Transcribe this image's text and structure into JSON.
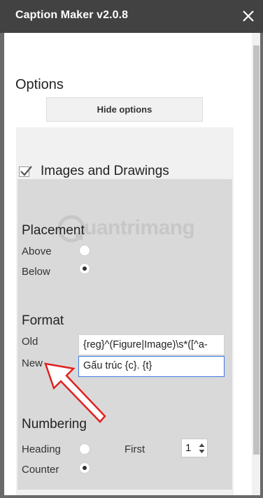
{
  "window": {
    "title": "Caption Maker v2.0.8"
  },
  "options": {
    "heading": "Options",
    "hide_button": "Hide options"
  },
  "images_drawings": {
    "label": "Images and Drawings",
    "checked": true
  },
  "placement": {
    "heading": "Placement",
    "above_label": "Above",
    "below_label": "Below",
    "selected": "Below"
  },
  "format": {
    "heading": "Format",
    "old_label": "Old",
    "old_value": "{reg}^(Figure|Image)\\s*([^a-",
    "new_label": "New",
    "new_value": "Gấu trúc {c}. {t}"
  },
  "numbering": {
    "heading": "Numbering",
    "heading_label": "Heading",
    "counter_label": "Counter",
    "selected": "Counter",
    "first_label": "First",
    "first_value": "1"
  },
  "watermark": {
    "text": "uantrimang"
  },
  "colors": {
    "titlebar": "#424242",
    "panel": "#d9d9d9",
    "annotation_arrow": "#e02020",
    "focus": "#3b78e7"
  }
}
